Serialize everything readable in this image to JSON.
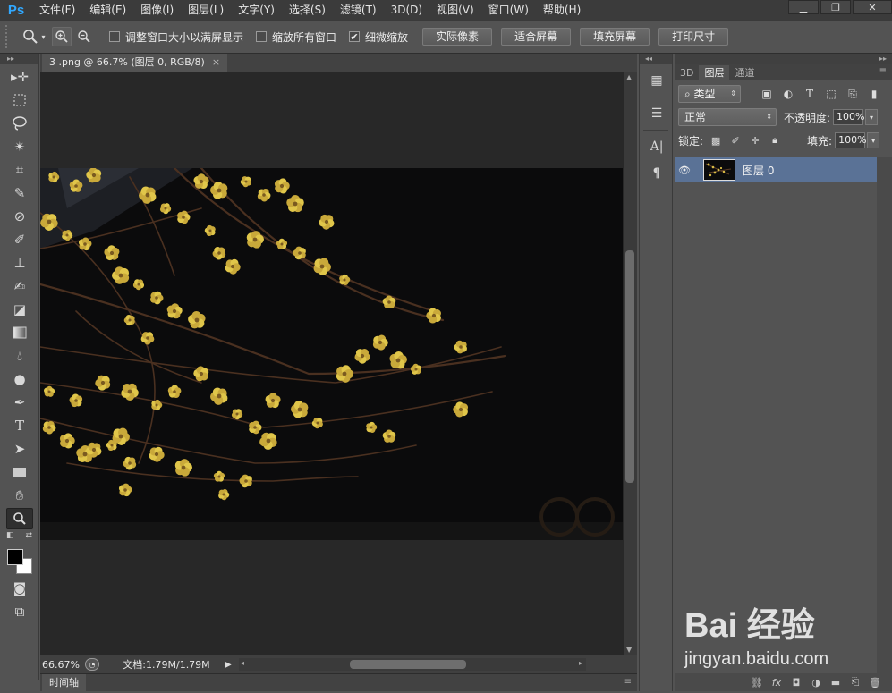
{
  "app": {
    "logo": "Ps"
  },
  "menus": [
    "文件(F)",
    "编辑(E)",
    "图像(I)",
    "图层(L)",
    "文字(Y)",
    "选择(S)",
    "滤镜(T)",
    "3D(D)",
    "视图(V)",
    "窗口(W)",
    "帮助(H)"
  ],
  "options": {
    "resize_windows": {
      "label": "调整窗口大小以满屏显示",
      "checked": false
    },
    "zoom_all": {
      "label": "缩放所有窗口",
      "checked": false
    },
    "scrubby_zoom": {
      "label": "细微缩放",
      "checked": true
    },
    "buttons": [
      "实际像素",
      "适合屏幕",
      "填充屏幕",
      "打印尺寸"
    ]
  },
  "document": {
    "tab_title": "3 .png @ 66.7% (图层 0, RGB/8)",
    "close": "×",
    "zoom": "66.67%",
    "doc_size": "文档:1.79M/1.79M"
  },
  "timeline": {
    "label": "时间轴"
  },
  "layers_panel": {
    "tabs": [
      "3D",
      "图层",
      "通道"
    ],
    "active_tab": "图层",
    "filter_label": "类型",
    "blend_mode": "正常",
    "opacity_label": "不透明度:",
    "opacity": "100%",
    "lock_label": "锁定:",
    "fill_label": "填充:",
    "fill": "100%",
    "layers": [
      {
        "name": "图层 0",
        "visible": true
      }
    ]
  },
  "watermark": {
    "logo": "Bai 经验",
    "url": "jingyan.baidu.com"
  },
  "colors": {
    "accent": "#31a8ff",
    "selected_layer": "#5a7296",
    "flower": "#e0c64a"
  }
}
